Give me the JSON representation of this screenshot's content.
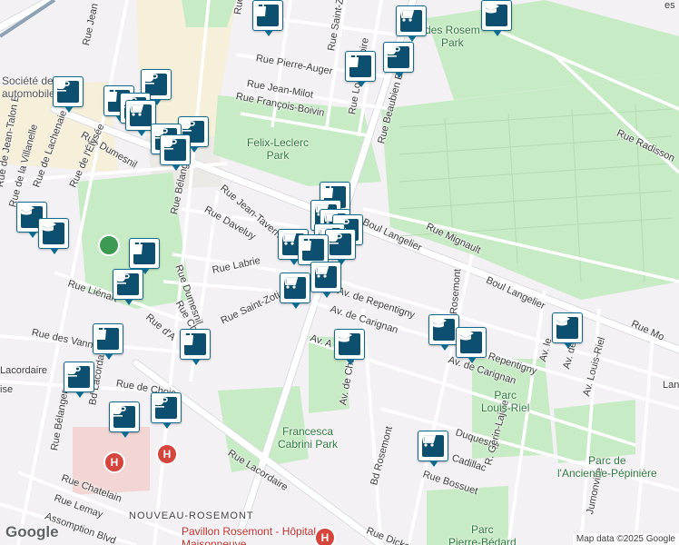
{
  "streets": {
    "rue_joncaire": "Rue Joncaire",
    "rue_saint_zotique_top": "Rue Saint-Zotique",
    "rue_pierre_auger": "Rue Pierre-Auger",
    "rue_jean_milot": "Rue Jean-Milot",
    "rue_louis_dupire": "Rue Louis-Dupire",
    "rue_francois_boivin": "Rue François-Boivin",
    "rue_beaubien": "Rue Beaubien E",
    "rue_jean_talon": "Rue de Jean-Talon E",
    "rue_dumesnil_top": "Rue Dumesnil",
    "rue_de_la_villanelle": "Rue de la Villanelle",
    "rue_lachenaie": "Rue de Lachenaie",
    "rue_elysee": "Rue de l'Élysée",
    "rue_belanger": "Rue Bélanger",
    "rue_jean_taverni": "Rue Jean-Taverni",
    "rue_daveluy": "Rue Daveluy",
    "rue_labrie": "Rue Labrie",
    "rue_dumesnil": "Rue Dumesnil",
    "rue_chaillot": "Rue Chaillot",
    "rue_liénart": "Rue Liénart",
    "rue_d_a": "Rue d'A",
    "rue_saint_zotique": "Rue Saint-Zotique",
    "rue_des_vannes": "Rue des Vannes",
    "rue_lacordaire_w": "Lacordaire",
    "rue_de_chois": "Rue de Chois",
    "bd_lacordaire": "Bd Lacordaire",
    "rue_belanger_bottom": "Rue Bélanger",
    "rue_lacordaire": "Rue Lacordaire",
    "rue_chatelain": "Rue Chatelain",
    "rue_lemay": "Rue Lemay",
    "assomption": "Assomption Blvd",
    "boul_langelier": "Boul Langelier",
    "boul_langelier_2": "Boul Langelier",
    "rue_mignault": "Rue Mignault",
    "rue_radisson": "Rue Radisson",
    "av_repentigny": "Av. de Repentigny",
    "av_carignan": "Av. de Carignan",
    "av_a": "Av. A",
    "av_charette": "Av. de Charette",
    "bd_rosemont": "Bd Rosemont",
    "bd_rosemont_top": "Rosemont",
    "repentigny_2": "Repentigny",
    "carignan_2": "Av. de Carignan",
    "av_le": "Av. le",
    "av_de": "Av. de",
    "av_louis_riel": "Av. Louis-Riel",
    "lan": "Lan",
    "rue_mont": "Rue Mo",
    "rue_bossuet": "Rue Bossuet",
    "cadillac": "Cadillac",
    "duquesne": "Duquesne",
    "gerin_lajoie": "R. Gérin-Lajoie",
    "jumonville": "Jumonville",
    "rue_dickson": "Rue Dicks",
    "rue_es": "es",
    "rue_e_w": "Rue",
    "rue_jean": "Rue Jean",
    "rue_ise": "ise",
    "rue_ire": "ire"
  },
  "parks": {
    "felix_leclerc": "Felix-Leclerc\nPark",
    "francesca": "Francesca\nCabrini Park",
    "louis_riel": "Parc\nLouis-Riel",
    "ancienne_pepiniere": "Parc de\nl'Ancienne-Pépinière",
    "pierre_bedard": "Parc\nPierre-Bédard",
    "des_roses": "des Rosem\nPark"
  },
  "places": {
    "societe": "Société de\nautomobile",
    "nouveau_rosemont": "NOUVEAU-ROSEMONT",
    "pavillon": "Pavillon Rosemont - Hôpital\nMaisonneuve"
  },
  "icons": {
    "coffee": "coffee-icon",
    "shopping_bag": "shopping-bag-icon",
    "cart": "shopping-cart-icon",
    "school": "graduation-cap-icon",
    "hospital": "hospital-icon",
    "tree": "park-tree-icon"
  },
  "colors": {
    "pin_border": "#0e6b8f",
    "pin_fill": "#0c4f6e",
    "park": "#c7ebc5",
    "hospital": "#d4463d",
    "road": "#ffffff",
    "background": "#f3f1f4"
  },
  "attribution": "Map data ©2025 Google",
  "logo": "Google"
}
